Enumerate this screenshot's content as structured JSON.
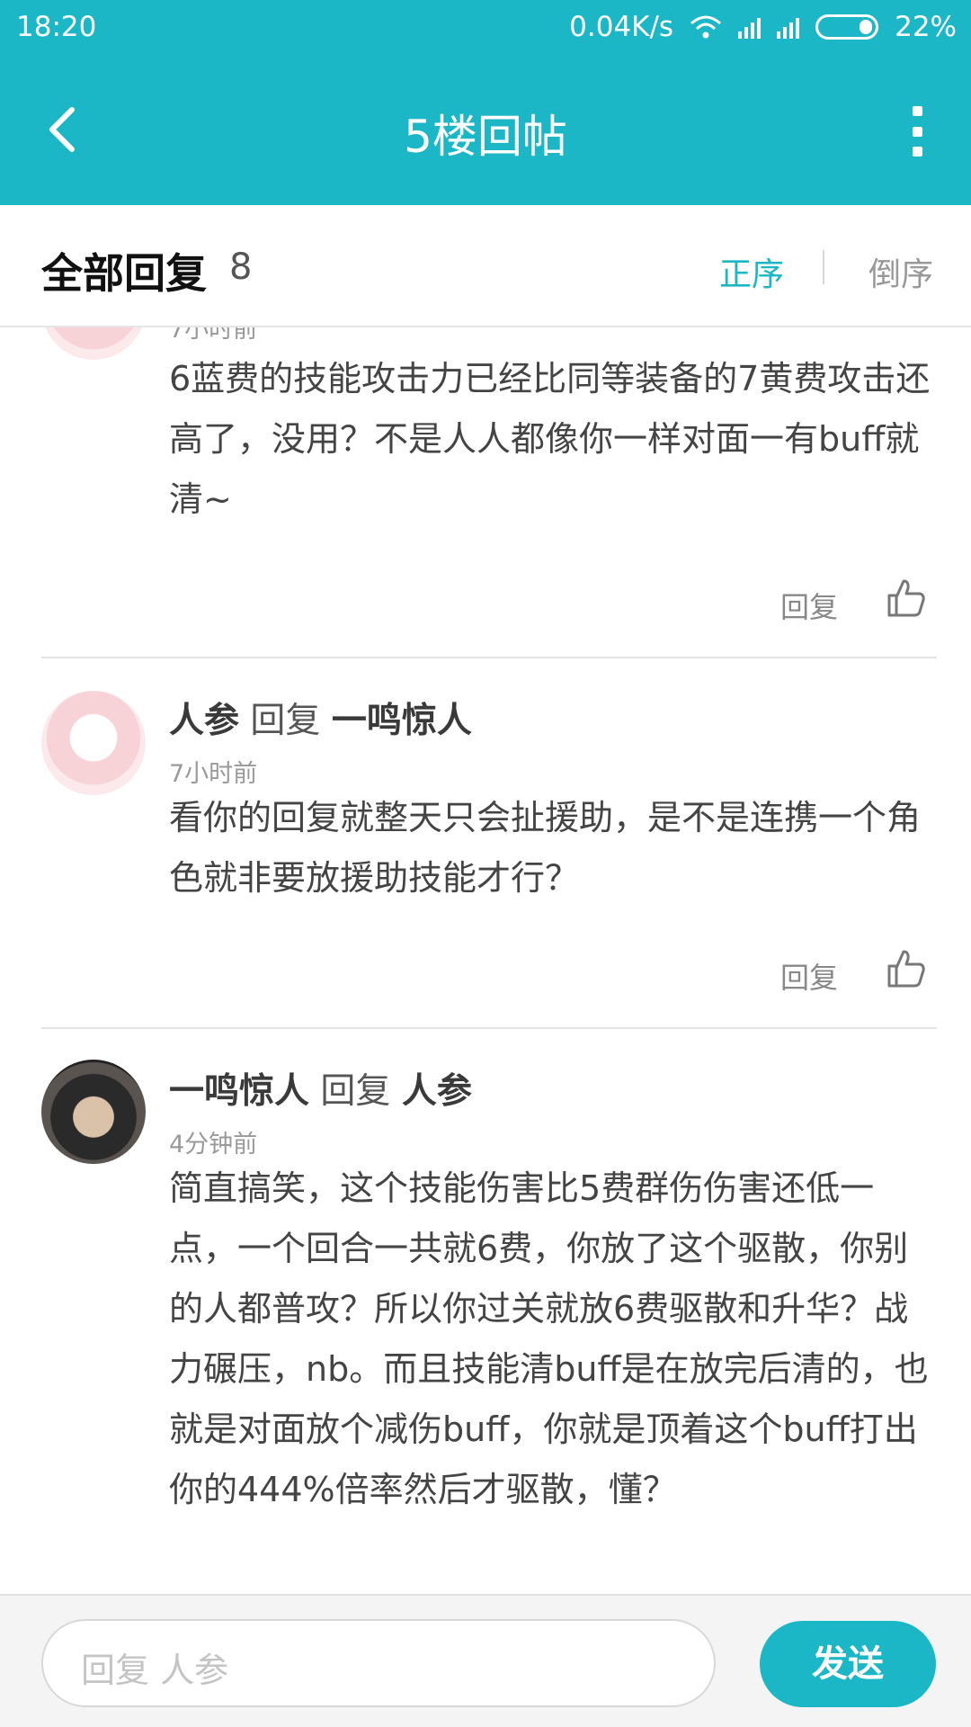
{
  "status_bar": {
    "time": "18:20",
    "speed": "0.04K/s",
    "battery": "22%"
  },
  "header": {
    "title": "5楼回帖"
  },
  "tabs": {
    "all_label": "全部回复",
    "count": "8",
    "asc_label": "正序",
    "desc_label": "倒序"
  },
  "comments": [
    {
      "time": "7小时前",
      "text": "6蓝费的技能攻击力已经比同等装备的7黄费攻击还高了，没用？不是人人都像你一样对面一有buff就清~",
      "reply_label": "回复"
    },
    {
      "author": "人参",
      "verb": "回复",
      "target": "一鸣惊人",
      "time": "7小时前",
      "text": "看你的回复就整天只会扯援助，是不是连携一个角色就非要放援助技能才行？",
      "reply_label": "回复"
    },
    {
      "author": "一鸣惊人",
      "verb": "回复",
      "target": "人参",
      "time": "4分钟前",
      "text": "简直搞笑，这个技能伤害比5费群伤伤害还低一点，一个回合一共就6费，你放了这个驱散，你别的人都普攻？所以你过关就放6费驱散和升华？战力碾压，nb。而且技能清buff是在放完后清的，也就是对面放个减伤buff，你就是顶着这个buff打出你的444%倍率然后才驱散，懂？"
    }
  ],
  "composer": {
    "placeholder": "回复 人参",
    "send_label": "发送"
  }
}
